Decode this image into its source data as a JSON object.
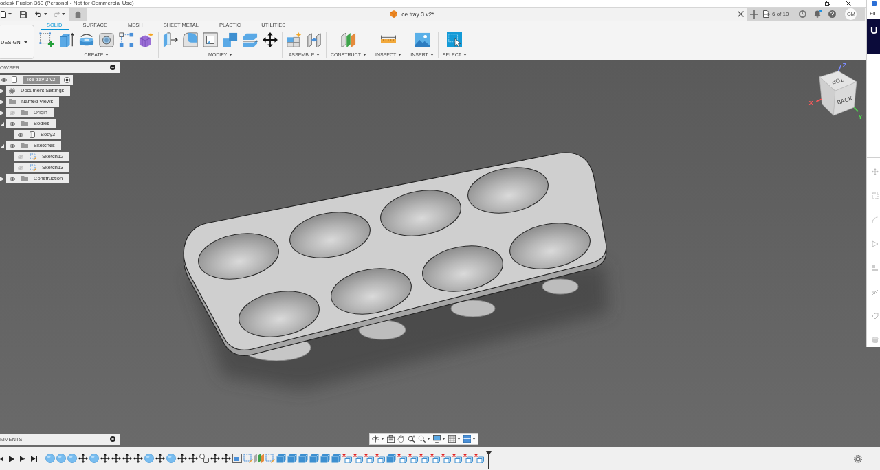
{
  "title_bar": {
    "title": "odesk Fusion 360 (Personal - Not for Commercial Use)"
  },
  "quick_access": {
    "undo": {
      "disabled": false
    },
    "redo": {
      "disabled": true
    }
  },
  "document_tab": {
    "title": "ice tray 3 v2*"
  },
  "account_bar": {
    "job_status": "6 of 10",
    "notifications": {
      "unread": true
    },
    "avatar": "GM"
  },
  "workspace": {
    "label": "DESIGN"
  },
  "ribbon": {
    "tabs": [
      {
        "label": "SOLID",
        "selected": true
      },
      {
        "label": "SURFACE",
        "selected": false
      },
      {
        "label": "MESH",
        "selected": false
      },
      {
        "label": "SHEET METAL",
        "selected": false
      },
      {
        "label": "PLASTIC",
        "selected": false
      },
      {
        "label": "UTILITIES",
        "selected": false
      }
    ],
    "groups": [
      {
        "label": "CREATE",
        "tools": [
          {
            "kind": "sketch"
          },
          {
            "kind": "extrude"
          },
          {
            "kind": "revolve"
          },
          {
            "kind": "hole"
          },
          {
            "kind": "pattern"
          },
          {
            "kind": "form"
          }
        ]
      },
      {
        "label": "MODIFY",
        "tools": [
          {
            "kind": "press_pull"
          },
          {
            "kind": "fillet"
          },
          {
            "kind": "shell"
          },
          {
            "kind": "combine"
          },
          {
            "kind": "split"
          },
          {
            "kind": "move"
          }
        ]
      },
      {
        "label": "ASSEMBLE",
        "tools": [
          {
            "kind": "component"
          },
          {
            "kind": "joint"
          }
        ]
      },
      {
        "label": "CONSTRUCT",
        "tools": [
          {
            "kind": "plane"
          }
        ]
      },
      {
        "label": "INSPECT",
        "tools": [
          {
            "kind": "measure"
          }
        ]
      },
      {
        "label": "INSERT",
        "tools": [
          {
            "kind": "image"
          }
        ]
      },
      {
        "label": "SELECT",
        "tools": [
          {
            "kind": "select"
          }
        ]
      }
    ]
  },
  "browser": {
    "title": "OWSER",
    "root": {
      "label": "ice tray 3 v2",
      "visible": true,
      "active": true,
      "children": [
        {
          "label": "Document Settings",
          "kind": "settings",
          "expanded": false
        },
        {
          "label": "Named Views",
          "kind": "folder",
          "expanded": false
        },
        {
          "label": "Origin",
          "kind": "folder",
          "visible": false,
          "expanded": false
        },
        {
          "label": "Bodies",
          "kind": "folder",
          "visible": true,
          "expanded": true,
          "children": [
            {
              "label": "Body3",
              "kind": "body",
              "visible": true
            }
          ]
        },
        {
          "label": "Sketches",
          "kind": "folder",
          "visible": true,
          "expanded": true,
          "children": [
            {
              "label": "Sketch12",
              "kind": "sketch",
              "visible": false
            },
            {
              "label": "Sketch13",
              "kind": "sketch",
              "visible": false
            }
          ]
        },
        {
          "label": "Construction",
          "kind": "folder",
          "visible": true,
          "expanded": false
        }
      ]
    }
  },
  "view_cube": {
    "top_face": "TOP",
    "side_face": "BACK",
    "axes": [
      {
        "label": "Z",
        "color": "#7d8cff"
      },
      {
        "label": "X",
        "color": "#ff5a5a"
      },
      {
        "label": "Y",
        "color": "#4fdc4f"
      }
    ]
  },
  "comments": {
    "title": "MMENTS"
  },
  "navigation_bar": {
    "tools": [
      {
        "kind": "orbit",
        "dropdown": true
      },
      {
        "kind": "look_at",
        "dropdown": false
      },
      {
        "kind": "pan",
        "dropdown": false
      },
      {
        "kind": "zoom",
        "dropdown": false
      },
      {
        "kind": "fit",
        "dropdown": true
      },
      {
        "kind": "display",
        "dropdown": true
      },
      {
        "kind": "grid",
        "dropdown": true
      },
      {
        "kind": "viewports",
        "dropdown": true
      }
    ]
  },
  "timeline": {
    "features": [
      {
        "kind": "sphere"
      },
      {
        "kind": "sphere"
      },
      {
        "kind": "sphere"
      },
      {
        "kind": "move"
      },
      {
        "kind": "sphere"
      },
      {
        "kind": "move"
      },
      {
        "kind": "move"
      },
      {
        "kind": "move"
      },
      {
        "kind": "move"
      },
      {
        "kind": "sphere"
      },
      {
        "kind": "move"
      },
      {
        "kind": "sphere"
      },
      {
        "kind": "move"
      },
      {
        "kind": "move"
      },
      {
        "kind": "joint"
      },
      {
        "kind": "move"
      },
      {
        "kind": "move"
      },
      {
        "kind": "canvas"
      },
      {
        "kind": "sketch"
      },
      {
        "kind": "plane"
      },
      {
        "kind": "sketch"
      },
      {
        "kind": "extrude"
      },
      {
        "kind": "extrude"
      },
      {
        "kind": "extrude"
      },
      {
        "kind": "extrude"
      },
      {
        "kind": "extrude"
      },
      {
        "kind": "extrude"
      },
      {
        "kind": "remove"
      },
      {
        "kind": "remove"
      },
      {
        "kind": "remove"
      },
      {
        "kind": "remove"
      },
      {
        "kind": "extrude"
      },
      {
        "kind": "remove"
      },
      {
        "kind": "remove"
      },
      {
        "kind": "remove"
      },
      {
        "kind": "remove"
      },
      {
        "kind": "remove"
      },
      {
        "kind": "remove"
      },
      {
        "kind": "remove"
      },
      {
        "kind": "remove"
      }
    ]
  },
  "side_window": {
    "menu_label": "Fil",
    "banner_text": "U"
  }
}
